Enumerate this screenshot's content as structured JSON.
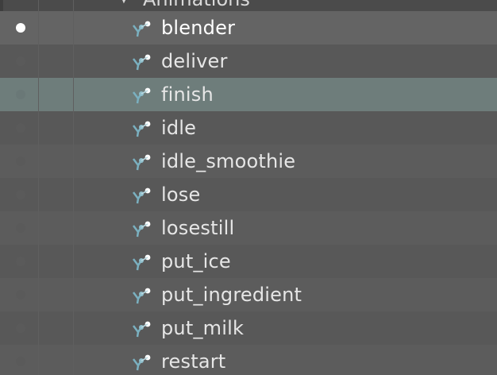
{
  "parent": {
    "label": "Animations",
    "icon": "animation-folder-icon"
  },
  "items": [
    {
      "label": "blender",
      "visible": true
    },
    {
      "label": "deliver",
      "visible": false
    },
    {
      "label": "finish",
      "visible": false,
      "selected": true
    },
    {
      "label": "idle",
      "visible": false
    },
    {
      "label": "idle_smoothie",
      "visible": false
    },
    {
      "label": "lose",
      "visible": false
    },
    {
      "label": "losestill",
      "visible": false
    },
    {
      "label": "put_ice",
      "visible": false
    },
    {
      "label": "put_ingredient",
      "visible": false
    },
    {
      "label": "put_milk",
      "visible": false
    },
    {
      "label": "restart",
      "visible": false
    }
  ],
  "colors": {
    "background": "#4b4b4b",
    "selected_row": "#6e7d7b",
    "active_row": "#646464",
    "text": "#e6e6e6",
    "icon_accent": "#6fa8b8"
  }
}
